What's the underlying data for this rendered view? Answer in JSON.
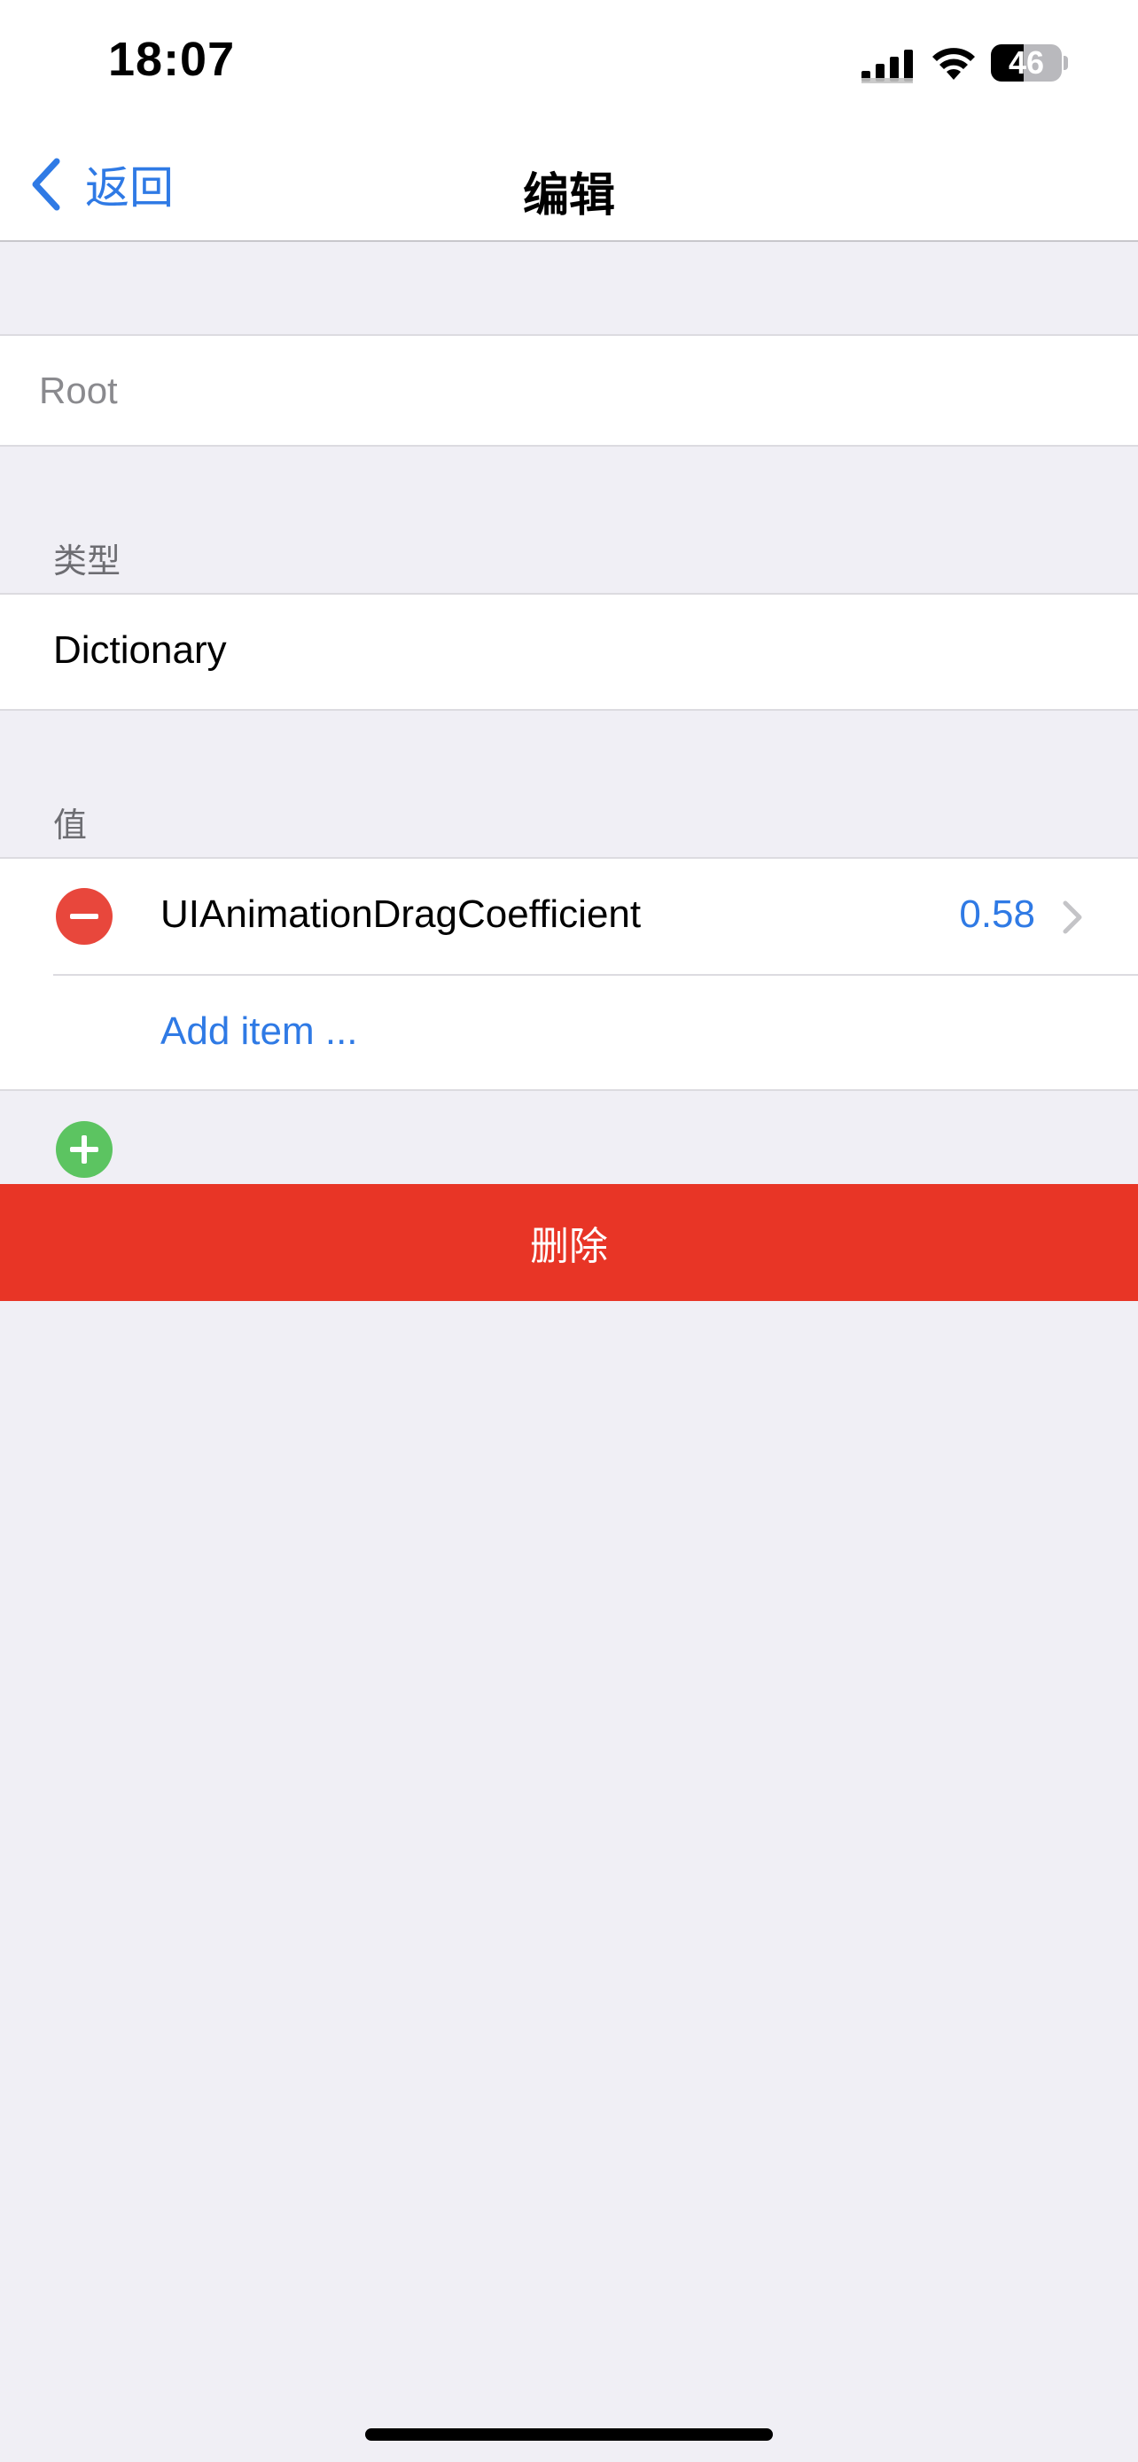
{
  "status_bar": {
    "time": "18:07",
    "battery_level": "46",
    "battery_fraction": 0.46,
    "icons": [
      "cellular-signal-icon",
      "wifi-icon",
      "battery-icon"
    ]
  },
  "nav": {
    "back_label": "返回",
    "title": "编辑"
  },
  "root_field": {
    "placeholder": "Root",
    "value": ""
  },
  "type_section": {
    "header": "类型",
    "value": "Dictionary"
  },
  "value_section": {
    "header": "值",
    "items": [
      {
        "key": "UIAnimationDragCoefficient",
        "value": "0.58"
      }
    ],
    "add_label": "Add item ..."
  },
  "delete_button": {
    "label": "删除"
  },
  "colors": {
    "accent": "#2f7ae5",
    "destructive": "#e83526",
    "remove": "#e8473c",
    "add": "#5cc461",
    "background": "#f0eff5"
  }
}
